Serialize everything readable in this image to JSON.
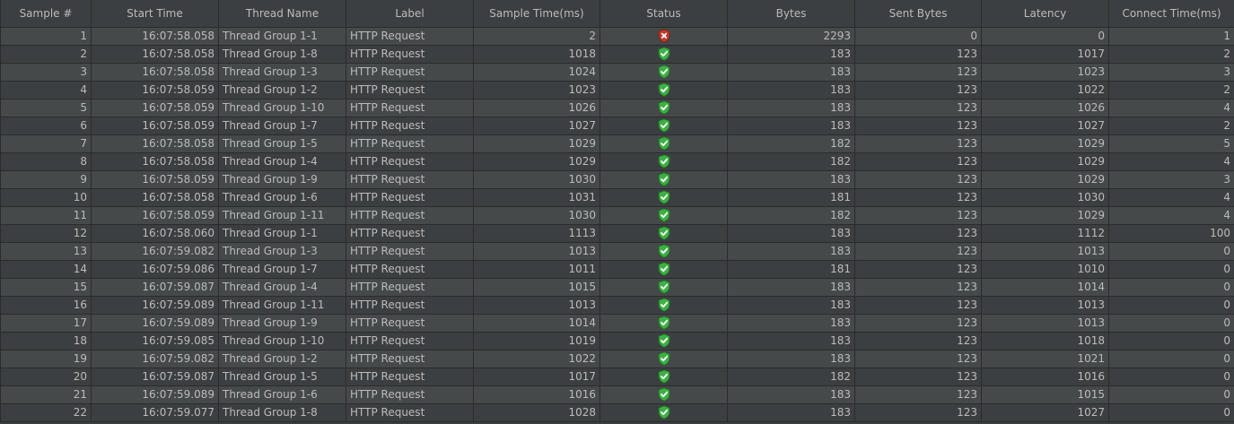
{
  "columns": [
    "Sample #",
    "Start Time",
    "Thread Name",
    "Label",
    "Sample Time(ms)",
    "Status",
    "Bytes",
    "Sent Bytes",
    "Latency",
    "Connect Time(ms)"
  ],
  "status_icons": {
    "ok": "success-shield-icon",
    "error": "error-shield-icon"
  },
  "colors": {
    "ok": "#3cb043",
    "error": "#c0392b"
  },
  "rows": [
    {
      "sample": "1",
      "start_time": "16:07:58.058",
      "thread_name": "Thread Group 1-1",
      "label": "HTTP Request",
      "sample_time": "2",
      "status": "error",
      "bytes": "2293",
      "sent_bytes": "0",
      "latency": "0",
      "connect_time": "1"
    },
    {
      "sample": "2",
      "start_time": "16:07:58.058",
      "thread_name": "Thread Group 1-8",
      "label": "HTTP Request",
      "sample_time": "1018",
      "status": "ok",
      "bytes": "183",
      "sent_bytes": "123",
      "latency": "1017",
      "connect_time": "2"
    },
    {
      "sample": "3",
      "start_time": "16:07:58.058",
      "thread_name": "Thread Group 1-3",
      "label": "HTTP Request",
      "sample_time": "1024",
      "status": "ok",
      "bytes": "183",
      "sent_bytes": "123",
      "latency": "1023",
      "connect_time": "3"
    },
    {
      "sample": "4",
      "start_time": "16:07:58.059",
      "thread_name": "Thread Group 1-2",
      "label": "HTTP Request",
      "sample_time": "1023",
      "status": "ok",
      "bytes": "183",
      "sent_bytes": "123",
      "latency": "1022",
      "connect_time": "2"
    },
    {
      "sample": "5",
      "start_time": "16:07:58.059",
      "thread_name": "Thread Group 1-10",
      "label": "HTTP Request",
      "sample_time": "1026",
      "status": "ok",
      "bytes": "183",
      "sent_bytes": "123",
      "latency": "1026",
      "connect_time": "4"
    },
    {
      "sample": "6",
      "start_time": "16:07:58.059",
      "thread_name": "Thread Group 1-7",
      "label": "HTTP Request",
      "sample_time": "1027",
      "status": "ok",
      "bytes": "183",
      "sent_bytes": "123",
      "latency": "1027",
      "connect_time": "2"
    },
    {
      "sample": "7",
      "start_time": "16:07:58.058",
      "thread_name": "Thread Group 1-5",
      "label": "HTTP Request",
      "sample_time": "1029",
      "status": "ok",
      "bytes": "182",
      "sent_bytes": "123",
      "latency": "1029",
      "connect_time": "5"
    },
    {
      "sample": "8",
      "start_time": "16:07:58.058",
      "thread_name": "Thread Group 1-4",
      "label": "HTTP Request",
      "sample_time": "1029",
      "status": "ok",
      "bytes": "182",
      "sent_bytes": "123",
      "latency": "1029",
      "connect_time": "4"
    },
    {
      "sample": "9",
      "start_time": "16:07:58.059",
      "thread_name": "Thread Group 1-9",
      "label": "HTTP Request",
      "sample_time": "1030",
      "status": "ok",
      "bytes": "183",
      "sent_bytes": "123",
      "latency": "1029",
      "connect_time": "3"
    },
    {
      "sample": "10",
      "start_time": "16:07:58.058",
      "thread_name": "Thread Group 1-6",
      "label": "HTTP Request",
      "sample_time": "1031",
      "status": "ok",
      "bytes": "181",
      "sent_bytes": "123",
      "latency": "1030",
      "connect_time": "4"
    },
    {
      "sample": "11",
      "start_time": "16:07:58.059",
      "thread_name": "Thread Group 1-11",
      "label": "HTTP Request",
      "sample_time": "1030",
      "status": "ok",
      "bytes": "182",
      "sent_bytes": "123",
      "latency": "1029",
      "connect_time": "4"
    },
    {
      "sample": "12",
      "start_time": "16:07:58.060",
      "thread_name": "Thread Group 1-1",
      "label": "HTTP Request",
      "sample_time": "1113",
      "status": "ok",
      "bytes": "183",
      "sent_bytes": "123",
      "latency": "1112",
      "connect_time": "100"
    },
    {
      "sample": "13",
      "start_time": "16:07:59.082",
      "thread_name": "Thread Group 1-3",
      "label": "HTTP Request",
      "sample_time": "1013",
      "status": "ok",
      "bytes": "183",
      "sent_bytes": "123",
      "latency": "1013",
      "connect_time": "0"
    },
    {
      "sample": "14",
      "start_time": "16:07:59.086",
      "thread_name": "Thread Group 1-7",
      "label": "HTTP Request",
      "sample_time": "1011",
      "status": "ok",
      "bytes": "181",
      "sent_bytes": "123",
      "latency": "1010",
      "connect_time": "0"
    },
    {
      "sample": "15",
      "start_time": "16:07:59.087",
      "thread_name": "Thread Group 1-4",
      "label": "HTTP Request",
      "sample_time": "1015",
      "status": "ok",
      "bytes": "183",
      "sent_bytes": "123",
      "latency": "1014",
      "connect_time": "0"
    },
    {
      "sample": "16",
      "start_time": "16:07:59.089",
      "thread_name": "Thread Group 1-11",
      "label": "HTTP Request",
      "sample_time": "1013",
      "status": "ok",
      "bytes": "183",
      "sent_bytes": "123",
      "latency": "1013",
      "connect_time": "0"
    },
    {
      "sample": "17",
      "start_time": "16:07:59.089",
      "thread_name": "Thread Group 1-9",
      "label": "HTTP Request",
      "sample_time": "1014",
      "status": "ok",
      "bytes": "183",
      "sent_bytes": "123",
      "latency": "1013",
      "connect_time": "0"
    },
    {
      "sample": "18",
      "start_time": "16:07:59.085",
      "thread_name": "Thread Group 1-10",
      "label": "HTTP Request",
      "sample_time": "1019",
      "status": "ok",
      "bytes": "183",
      "sent_bytes": "123",
      "latency": "1018",
      "connect_time": "0"
    },
    {
      "sample": "19",
      "start_time": "16:07:59.082",
      "thread_name": "Thread Group 1-2",
      "label": "HTTP Request",
      "sample_time": "1022",
      "status": "ok",
      "bytes": "183",
      "sent_bytes": "123",
      "latency": "1021",
      "connect_time": "0"
    },
    {
      "sample": "20",
      "start_time": "16:07:59.087",
      "thread_name": "Thread Group 1-5",
      "label": "HTTP Request",
      "sample_time": "1017",
      "status": "ok",
      "bytes": "182",
      "sent_bytes": "123",
      "latency": "1016",
      "connect_time": "0"
    },
    {
      "sample": "21",
      "start_time": "16:07:59.089",
      "thread_name": "Thread Group 1-6",
      "label": "HTTP Request",
      "sample_time": "1016",
      "status": "ok",
      "bytes": "183",
      "sent_bytes": "123",
      "latency": "1015",
      "connect_time": "0"
    },
    {
      "sample": "22",
      "start_time": "16:07:59.077",
      "thread_name": "Thread Group 1-8",
      "label": "HTTP Request",
      "sample_time": "1028",
      "status": "ok",
      "bytes": "183",
      "sent_bytes": "123",
      "latency": "1027",
      "connect_time": "0"
    }
  ]
}
